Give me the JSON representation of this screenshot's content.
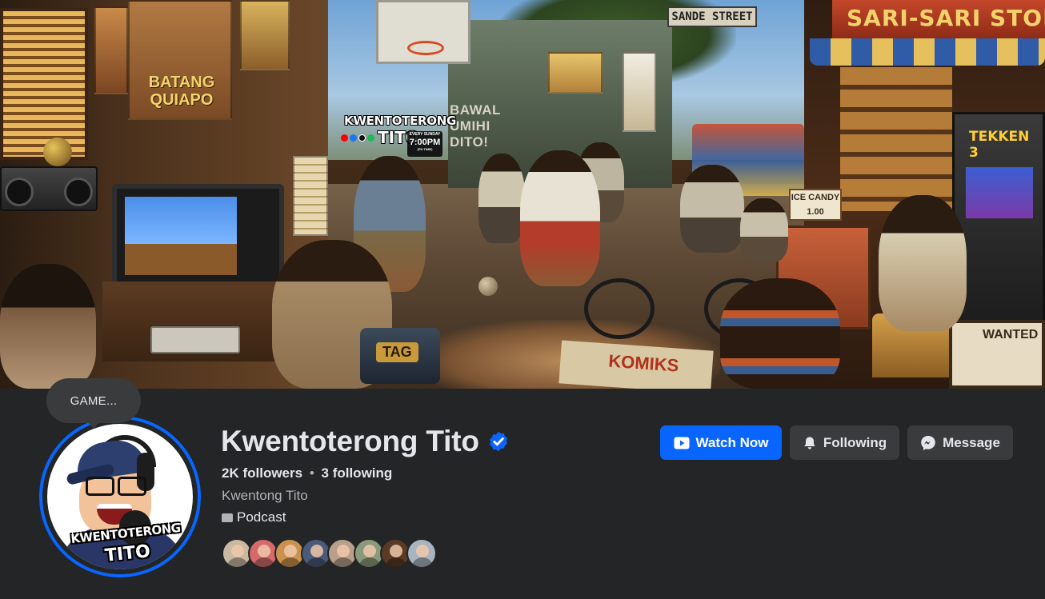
{
  "cover": {
    "sign_sande": "SANDE STREET",
    "sign_store": "SARI-SARI STORE",
    "sign_batang": "BATANG QUIAPO",
    "sign_bawal": "BAWAL UMIHI DITO!",
    "sign_tekken": "TEKKEN 3",
    "sign_ice": "ICE CANDY 1.00",
    "sign_wanted": "WANTED",
    "sign_komiks": "KOMIKS",
    "sign_tag": "TAG",
    "logo_line1": "KWENTOTERONG",
    "logo_line2": "TITO",
    "schedule_line1": "EVERY SUNDAY",
    "schedule_time": "7:00PM",
    "schedule_tz": "(PH TIME)"
  },
  "tooltip": {
    "text": "GAME..."
  },
  "avatar": {
    "line1": "KWENTOTERONG",
    "line2": "TITO",
    "ring_color": "#0866ff"
  },
  "profile": {
    "name": "Kwentoterong Tito",
    "verified": true,
    "followers": "2K followers",
    "following": "3 following",
    "separator": "•",
    "subtitle": "Kwentong Tito",
    "category": "Podcast"
  },
  "friends": {
    "colors": [
      "#c9b8a2",
      "#d46a6a",
      "#c9924e",
      "#4a5a7a",
      "#b8a08a",
      "#8a9a7a",
      "#5a3a24",
      "#a8b4c0"
    ]
  },
  "actions": {
    "watch_now": "Watch Now",
    "following": "Following",
    "message": "Message"
  },
  "colors": {
    "accent": "#0866ff",
    "background": "#242526",
    "button_secondary": "#3a3b3c",
    "text_primary": "#e4e6eb",
    "text_secondary": "#b0b3b8"
  }
}
